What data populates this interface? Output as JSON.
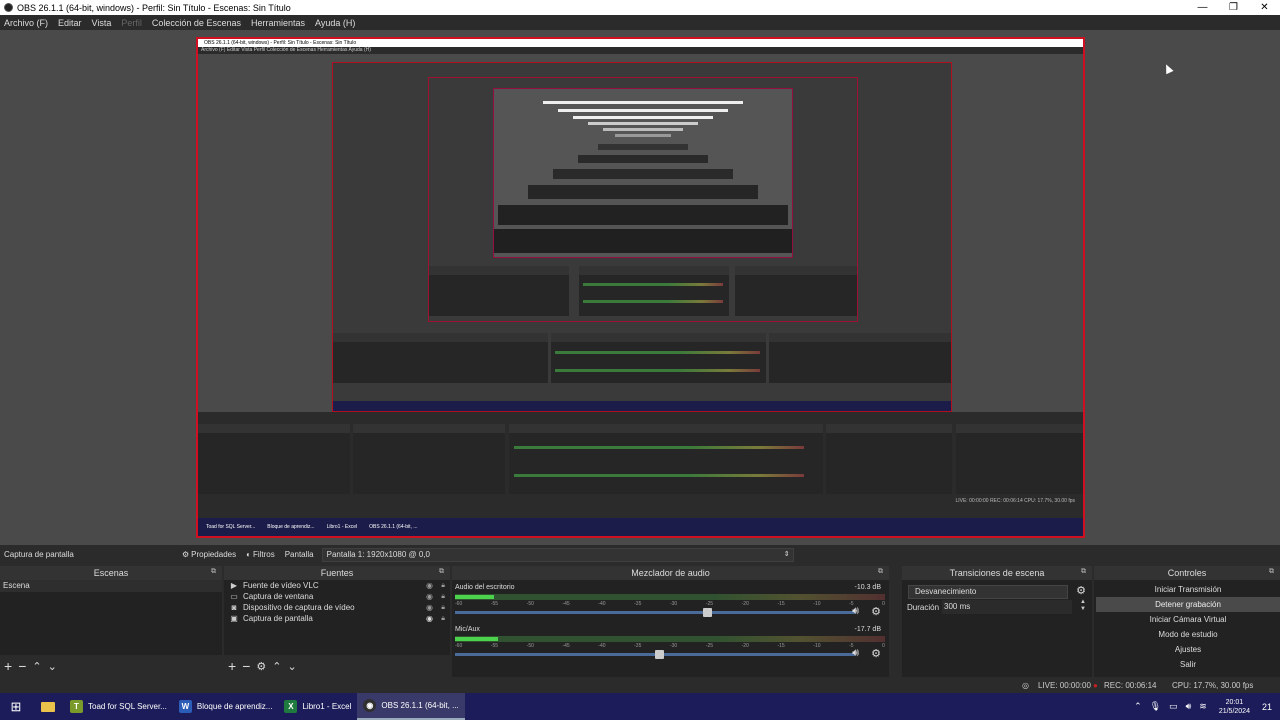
{
  "window": {
    "title": "OBS 26.1.1 (64-bit, windows) - Perfil: Sin Título - Escenas: Sin Título",
    "controls": [
      "—",
      "❐",
      "✕"
    ]
  },
  "menu": [
    "Archivo (F)",
    "Editar",
    "Vista",
    "Perfil",
    "Colección de Escenas",
    "Herramientas",
    "Ayuda (H)"
  ],
  "nested": {
    "title": "OBS 26.1.1 (64-bit, windows) - Perfil: Sin Título - Escenas: Sin Título",
    "menu": "Archivo (F)   Editar   Vista   Perfil   Colección de Escenas   Herramientas   Ayuda (H)",
    "taskbar": [
      "Toad for SQL Server...",
      "Bloque de aprendiz...",
      "Libro1 - Excel",
      "OBS 26.1.1 (64-bit, ..."
    ],
    "status": "LIVE: 00:00:00    REC: 00:06:14    CPU: 17.7%, 30.00 fps"
  },
  "source_bar": {
    "label": "Captura de pantalla",
    "properties": "Propiedades",
    "filters": "Filtros",
    "pantalla_label": "Pantalla",
    "pantalla_value": "Pantalla 1: 1920x1080 @ 0,0"
  },
  "scenes": {
    "title": "Escenas",
    "items": [
      "Escena"
    ]
  },
  "sources": {
    "title": "Fuentes",
    "items": [
      {
        "icon": "play-icon",
        "label": "Fuente de vídeo VLC"
      },
      {
        "icon": "window-icon",
        "label": "Captura de ventana"
      },
      {
        "icon": "camera-icon",
        "label": "Dispositivo de captura de vídeo"
      },
      {
        "icon": "monitor-icon",
        "label": "Captura de pantalla"
      }
    ]
  },
  "mixer": {
    "title": "Mezclador de audio",
    "channels": [
      {
        "name": "Audio del escritorio",
        "db": "-10.3 dB",
        "level": 0.09,
        "fader": 0.63
      },
      {
        "name": "Mic/Aux",
        "db": "-17.7 dB",
        "level": 0.1,
        "fader": 0.51
      }
    ],
    "ticks": [
      "-60",
      "-55",
      "-50",
      "-45",
      "-40",
      "-35",
      "-30",
      "-25",
      "-20",
      "-15",
      "-10",
      "-5",
      "0"
    ]
  },
  "transitions": {
    "title": "Transiciones de escena",
    "selected": "Desvanecimiento",
    "duration_label": "Duración",
    "duration_value": "300 ms"
  },
  "controls": {
    "title": "Controles",
    "buttons": [
      "Iniciar Transmisión",
      "Detener grabación",
      "Iniciar Cámara Virtual",
      "Modo de estudio",
      "Ajustes",
      "Salir"
    ]
  },
  "status": {
    "live": "LIVE: 00:00:00",
    "rec": "REC: 00:06:14",
    "cpu": "CPU: 17.7%, 30.00 fps"
  },
  "taskbar": {
    "apps": [
      {
        "label": "Toad for SQL Server...",
        "color": "#7a9a2a",
        "icon": "toad-icon",
        "glyph": "T"
      },
      {
        "label": "Bloque de aprendiz...",
        "color": "#2b5cb8",
        "icon": "word-icon",
        "glyph": "W"
      },
      {
        "label": "Libro1 - Excel",
        "color": "#1e7a3e",
        "icon": "excel-icon",
        "glyph": "X"
      },
      {
        "label": "OBS 26.1.1 (64-bit, ...",
        "color": "#303030",
        "icon": "obs-icon",
        "glyph": "◉"
      }
    ],
    "time": "20:01",
    "date": "21/5/2024",
    "notifications": "21"
  }
}
